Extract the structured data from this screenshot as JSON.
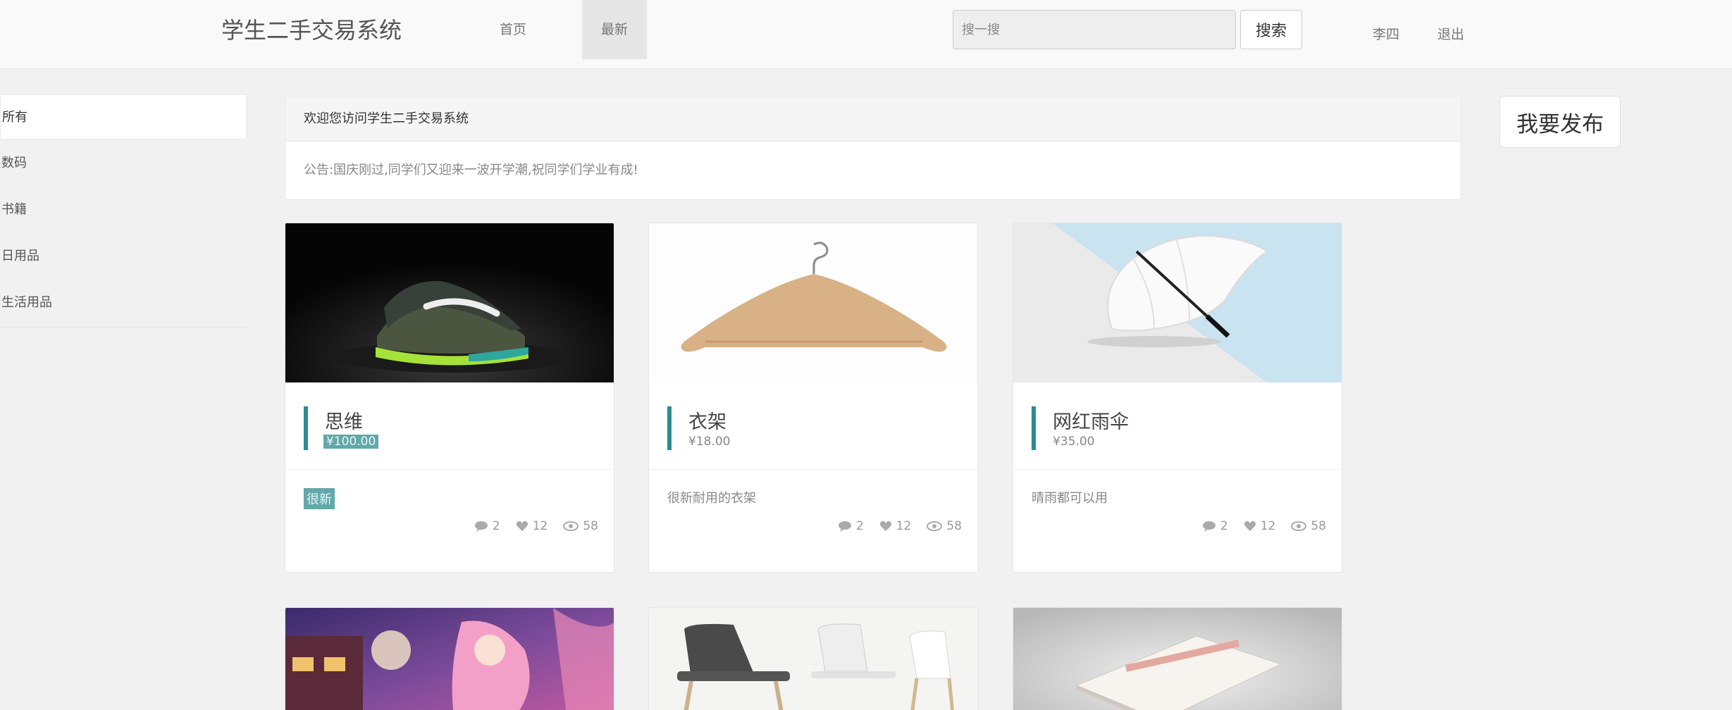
{
  "header": {
    "brand": "学生二手交易系统",
    "nav": {
      "home": "首页",
      "latest": "最新"
    },
    "search": {
      "placeholder": "搜一搜",
      "button": "搜索"
    },
    "user": {
      "name": "李四",
      "logout": "退出"
    }
  },
  "sidebar": {
    "items": [
      {
        "label": "所有"
      },
      {
        "label": "数码"
      },
      {
        "label": "书籍"
      },
      {
        "label": "日用品"
      },
      {
        "label": "生活用品"
      }
    ]
  },
  "panel": {
    "title": "欢迎您访问学生二手交易系统",
    "notice": "公告:国庆刚过,同学们又迎来一波开学潮,祝同学们学业有成!"
  },
  "publish_button": "我要发布",
  "products": [
    {
      "name": "思维",
      "price": "¥100.00",
      "desc": "很新",
      "comments": "2",
      "likes": "12",
      "views": "58"
    },
    {
      "name": "衣架",
      "price": "¥18.00",
      "desc": "很新耐用的衣架",
      "comments": "2",
      "likes": "12",
      "views": "58"
    },
    {
      "name": "网红雨伞",
      "price": "¥35.00",
      "desc": "晴雨都可以用",
      "comments": "2",
      "likes": "12",
      "views": "58"
    }
  ],
  "colors": {
    "accent": "#2a8c8f",
    "highlight": "#62a7a9",
    "background": "#f1f1f1"
  }
}
